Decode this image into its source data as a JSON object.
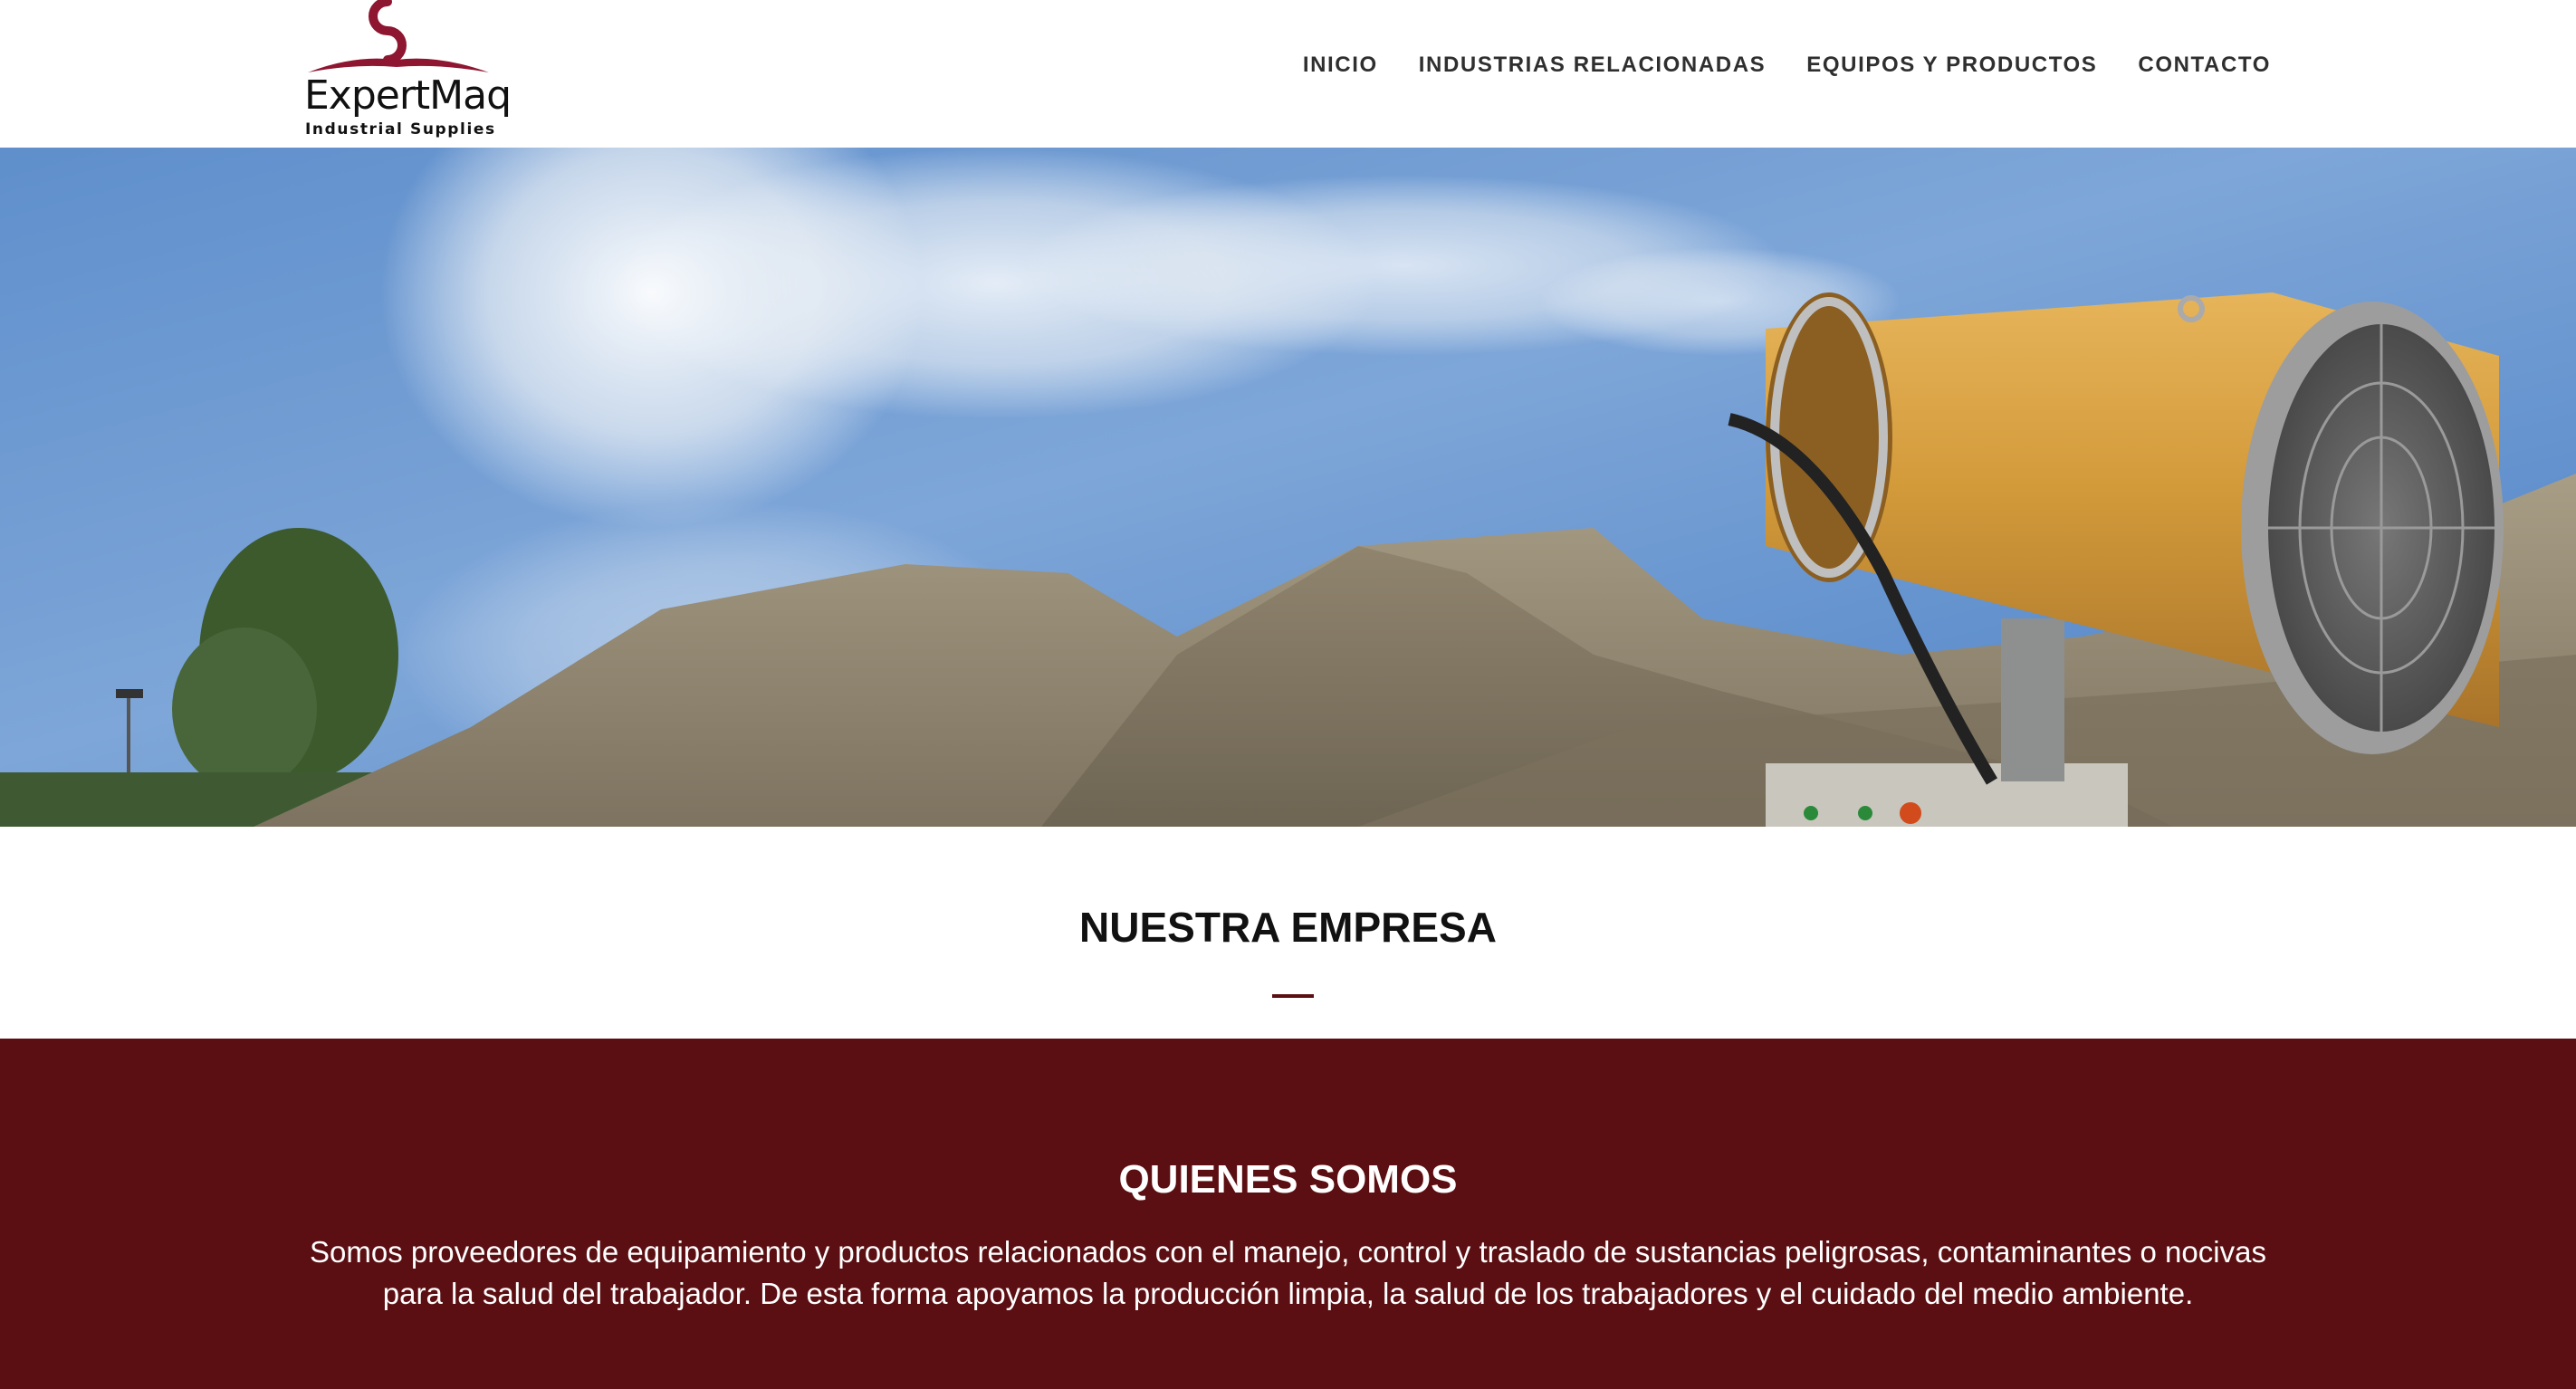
{
  "header": {
    "logo_name": "ExpertMaq",
    "logo_tagline": "Industrial Supplies",
    "nav": [
      {
        "label": "INICIO"
      },
      {
        "label": "INDUSTRIAS RELACIONADAS"
      },
      {
        "label": "EQUIPOS Y PRODUCTOS"
      },
      {
        "label": "CONTACTO"
      }
    ]
  },
  "hero": {
    "image": "dust-suppression-cannon-photo"
  },
  "section": {
    "title": "NUESTRA EMPRESA"
  },
  "about": {
    "heading": "QUIENES SOMOS",
    "body": "Somos proveedores de equipamiento y productos relacionados con el manejo, control y traslado de sustancias peligrosas, contaminantes o nocivas para la salud del trabajador. De esta forma apoyamos la producción limpia, la salud de los trabajadores y el cuidado del medio ambiente."
  },
  "colors": {
    "brand": "#5c0f12",
    "logo_accent": "#8e1630",
    "nav_text": "#2f2f2f"
  }
}
